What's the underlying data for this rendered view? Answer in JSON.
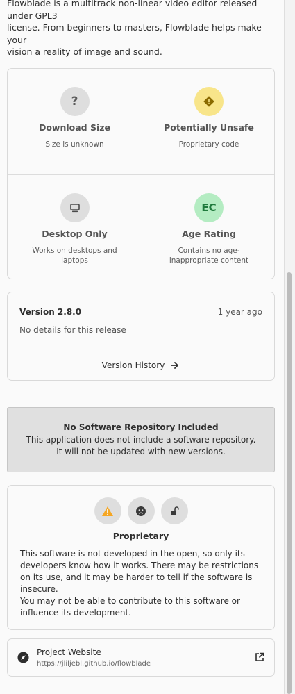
{
  "intro": {
    "line1": "Flowblade is a multitrack non-linear video editor released under GPL3",
    "line2": "license. From beginners to masters, Flowblade helps make your",
    "line3": "vision a reality of image and sound."
  },
  "context_tiles": [
    {
      "icon": "question-mark",
      "glyph": "?",
      "title": "Download Size",
      "subtitle": "Size is unknown",
      "circle_color": "#dedede",
      "glyph_color": "#5a5a5a"
    },
    {
      "icon": "warning-diamond",
      "glyph": "",
      "title": "Potentially Unsafe",
      "subtitle": "Proprietary code",
      "circle_color": "#f8e58a",
      "glyph_color": "#8a6a00"
    },
    {
      "icon": "monitor",
      "glyph": "",
      "title": "Desktop Only",
      "subtitle": "Works on desktops and laptops",
      "circle_color": "#dedede",
      "glyph_color": "#4a4a4a"
    },
    {
      "icon": "age-rating-badge",
      "glyph": "EC",
      "title": "Age Rating",
      "subtitle": "Contains no age-inappropriate content",
      "circle_color": "#b4ecc2",
      "glyph_color": "#1f7a3c"
    }
  ],
  "version": {
    "name": "Version 2.8.0",
    "date": "1 year ago",
    "details": "No details for this release",
    "history_label": "Version History"
  },
  "repository": {
    "title": "No Software Repository Included",
    "description": "This application does not include a software repository. It will not be updated with new versions."
  },
  "license": {
    "icons": [
      "warning-icon",
      "sad-face-icon",
      "unlocked-icon"
    ],
    "title": "Proprietary",
    "paragraph1": "This software is not developed in the open, so only its developers know how it works. There may be restrictions on its use, and it may be harder to tell if the software is insecure.",
    "paragraph2": "You may not be able to contribute to this software or influence its development."
  },
  "website": {
    "title": "Project Website",
    "url": "https://jliljebl.github.io/flowblade"
  },
  "colors": {
    "accent_warning": "#f5a623",
    "repo_background": "#e0e0e0",
    "border": "#d9d9d9"
  }
}
